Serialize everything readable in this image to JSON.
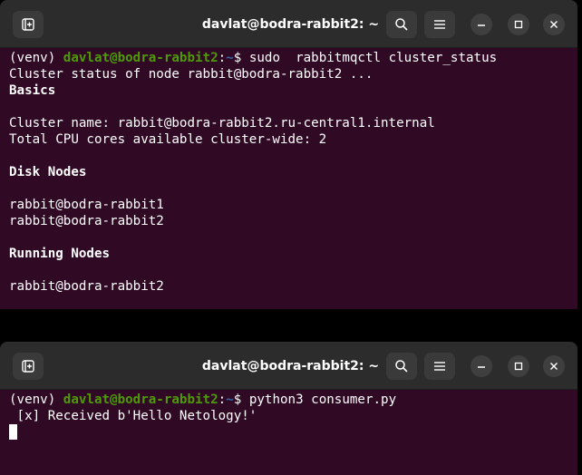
{
  "windows": [
    {
      "title": "davlat@bodra-rabbit2: ~",
      "prompt": {
        "venv": "(venv) ",
        "user_host": "davlat@bodra-rabbit2",
        "colon": ":",
        "path": "~",
        "symbol": "$ ",
        "command": "sudo  rabbitmqctl cluster_status"
      },
      "output": [
        {
          "text": "Cluster status of node rabbit@bodra-rabbit2 ...",
          "bold": false
        },
        {
          "text": "Basics",
          "bold": true
        },
        {
          "text": "",
          "bold": false
        },
        {
          "text": "Cluster name: rabbit@bodra-rabbit2.ru-central1.internal",
          "bold": false
        },
        {
          "text": "Total CPU cores available cluster-wide: 2",
          "bold": false
        },
        {
          "text": "",
          "bold": false
        },
        {
          "text": "Disk Nodes",
          "bold": true
        },
        {
          "text": "",
          "bold": false
        },
        {
          "text": "rabbit@bodra-rabbit1",
          "bold": false
        },
        {
          "text": "rabbit@bodra-rabbit2",
          "bold": false
        },
        {
          "text": "",
          "bold": false
        },
        {
          "text": "Running Nodes",
          "bold": true
        },
        {
          "text": "",
          "bold": false
        },
        {
          "text": "rabbit@bodra-rabbit2",
          "bold": false
        }
      ]
    },
    {
      "title": "davlat@bodra-rabbit2: ~",
      "prompt": {
        "venv": "(venv) ",
        "user_host": "davlat@bodra-rabbit2",
        "colon": ":",
        "path": "~",
        "symbol": "$ ",
        "command": "python3 consumer.py"
      },
      "output": [
        {
          "text": " [x] Received b'Hello Netology!'",
          "bold": false
        }
      ]
    }
  ],
  "icons": {
    "new_tab": "new-tab-icon",
    "search": "search-icon",
    "menu": "hamburger-menu-icon",
    "minimize": "minimize-icon",
    "maximize": "maximize-icon",
    "close": "close-icon"
  },
  "colors": {
    "terminal_bg": "#300a24",
    "titlebar_bg": "#2c2c2c",
    "prompt_user": "#4e9a06",
    "prompt_path": "#3465a4"
  }
}
